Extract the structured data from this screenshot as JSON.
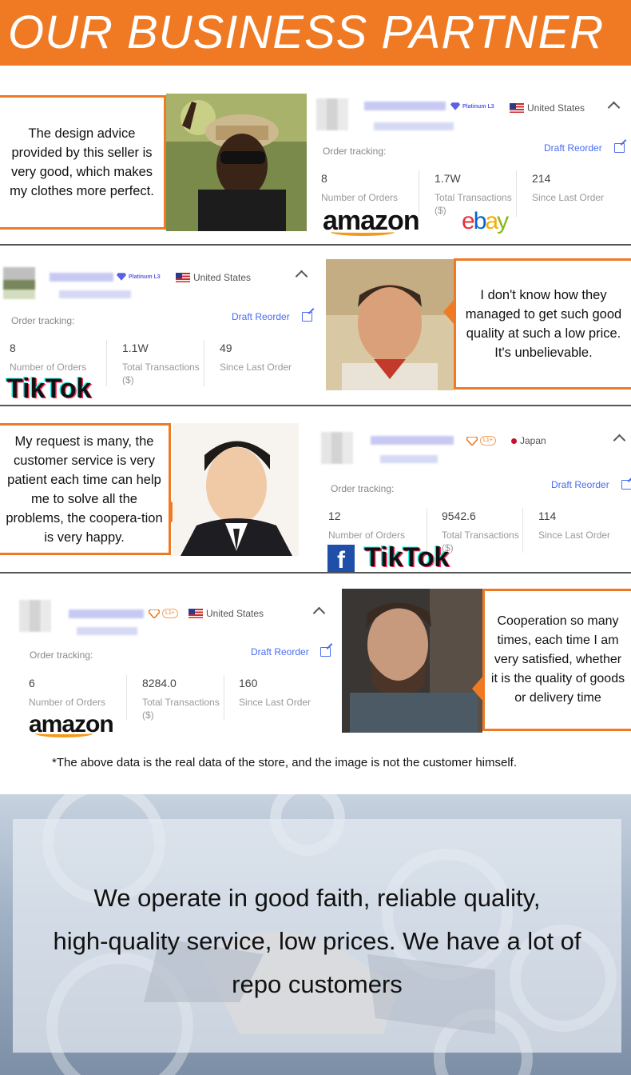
{
  "header": {
    "title": "OUR BUSINESS PARTNER"
  },
  "testimonials": [
    {
      "text": "The design advice provided by this seller is very good, which makes my clothes more perfect."
    },
    {
      "text": "I don't know how they managed to get such good quality at such a low price. It's unbelievable."
    },
    {
      "text": "My request is many, the customer service is very patient each time can help me to solve all the problems, the coopera-tion is very happy."
    },
    {
      "text": "Cooperation so many times, each time I am very satisfied, whether it is the quality of goods or delivery time"
    }
  ],
  "cards": [
    {
      "badge": "Platinum L3",
      "country": "United States",
      "order_tracking": "Order tracking:",
      "reorder": "Draft Reorder",
      "orders": "8",
      "orders_label": "Number of Orders",
      "transactions": "1.7W",
      "transactions_label": "Total Transactions",
      "transactions_unit": "($)",
      "since": "214",
      "since_label": "Since Last Order",
      "logos": [
        "amazon",
        "ebay"
      ]
    },
    {
      "badge": "Platinum L3",
      "country": "United States",
      "order_tracking": "Order tracking:",
      "reorder": "Draft Reorder",
      "orders": "8",
      "orders_label": "Number of Orders",
      "transactions": "1.1W",
      "transactions_label": "Total Transactions",
      "transactions_unit": "($)",
      "since": "49",
      "since_label": "Since Last Order",
      "logos": [
        "TikTok"
      ]
    },
    {
      "badge": "L1+",
      "country": "Japan",
      "order_tracking": "Order tracking:",
      "reorder": "Draft Reorder",
      "orders": "12",
      "orders_label": "Number of Orders",
      "transactions": "9542.6",
      "transactions_label": "Total Transactions",
      "transactions_unit": "($)",
      "since": "114",
      "since_label": "Since Last Order",
      "logos": [
        "facebook",
        "TikTok"
      ]
    },
    {
      "badge": "L1+",
      "country": "United States",
      "order_tracking": "Order tracking:",
      "reorder": "Draft Reorder",
      "orders": "6",
      "orders_label": "Number of Orders",
      "transactions": "8284.0",
      "transactions_label": "Total Transactions",
      "transactions_unit": "($)",
      "since": "160",
      "since_label": "Since Last Order",
      "logos": [
        "amazon"
      ]
    }
  ],
  "logo_text": {
    "amazon": "amazon",
    "ebay_e": "e",
    "ebay_b": "b",
    "ebay_a": "a",
    "ebay_y": "y",
    "tiktok": "TikTok",
    "facebook": "f"
  },
  "footnote": "*The above data is the real data of the store, and the image is not the customer himself.",
  "hero": {
    "line1": "We operate in good faith, reliable quality,",
    "line2": "high-quality service, low prices. We have a lot of",
    "line3": "repo customers"
  },
  "colors": {
    "accent": "#f07a24",
    "link": "#4a6cf0",
    "badge": "#5b5fe6"
  }
}
